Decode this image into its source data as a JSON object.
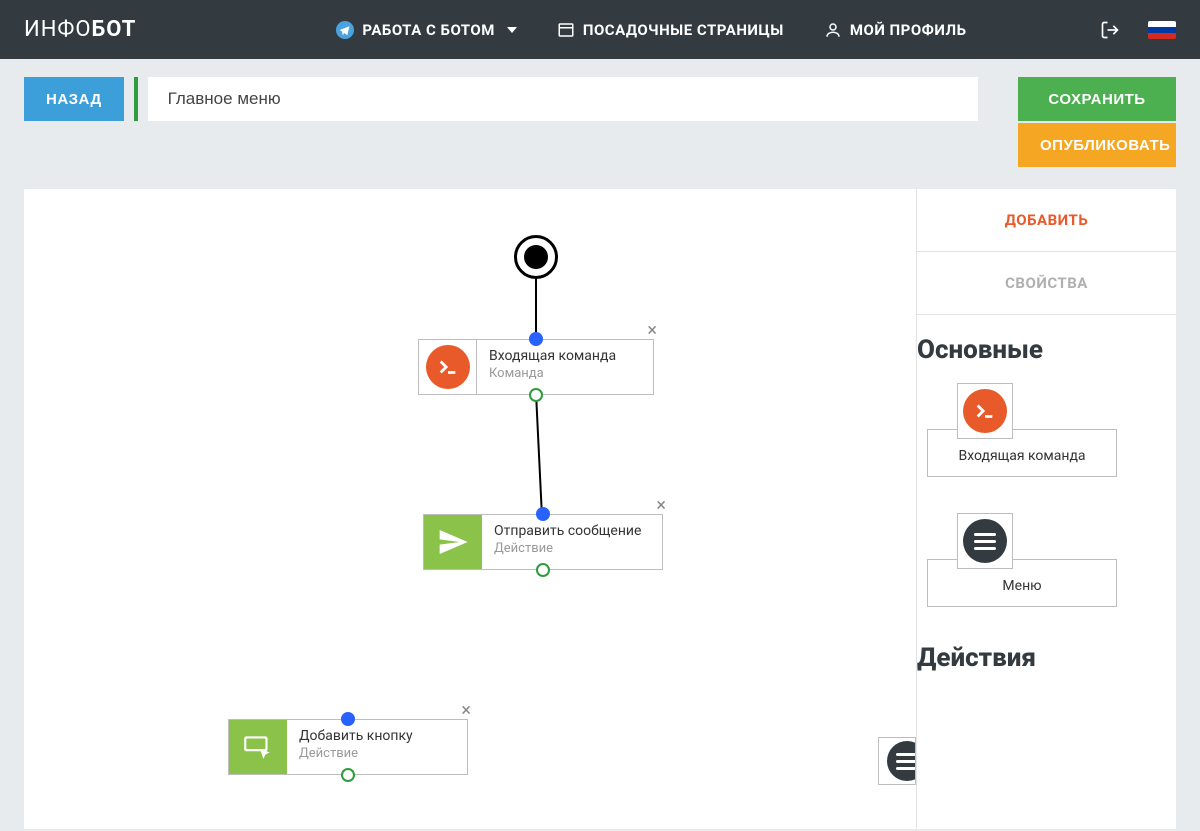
{
  "header": {
    "logo_light": "ИНФО",
    "logo_bold": "БОТ",
    "nav": {
      "work_with_bot": "РАБОТА С БОТОМ",
      "landing_pages": "ПОСАДОЧНЫЕ СТРАНИЦЫ",
      "profile": "МОЙ ПРОФИЛЬ"
    }
  },
  "toolbar": {
    "back": "НАЗАД",
    "title_value": "Главное меню",
    "save": "СОХРАНИТЬ",
    "publish": "ОПУБЛИКОВАТЬ"
  },
  "sidebar": {
    "tab_add": "ДОБАВИТЬ",
    "tab_props": "СВОЙСТВА",
    "section_basic": "Основные",
    "section_actions": "Действия",
    "palette": {
      "incoming_command": "Входящая команда",
      "menu": "Меню"
    }
  },
  "canvas": {
    "nodes": {
      "n1": {
        "title": "Входящая команда",
        "sub": "Команда"
      },
      "n2": {
        "title": "Отправить сообщение",
        "sub": "Действие"
      },
      "n3": {
        "title": "Добавить кнопку",
        "sub": "Действие"
      }
    }
  }
}
